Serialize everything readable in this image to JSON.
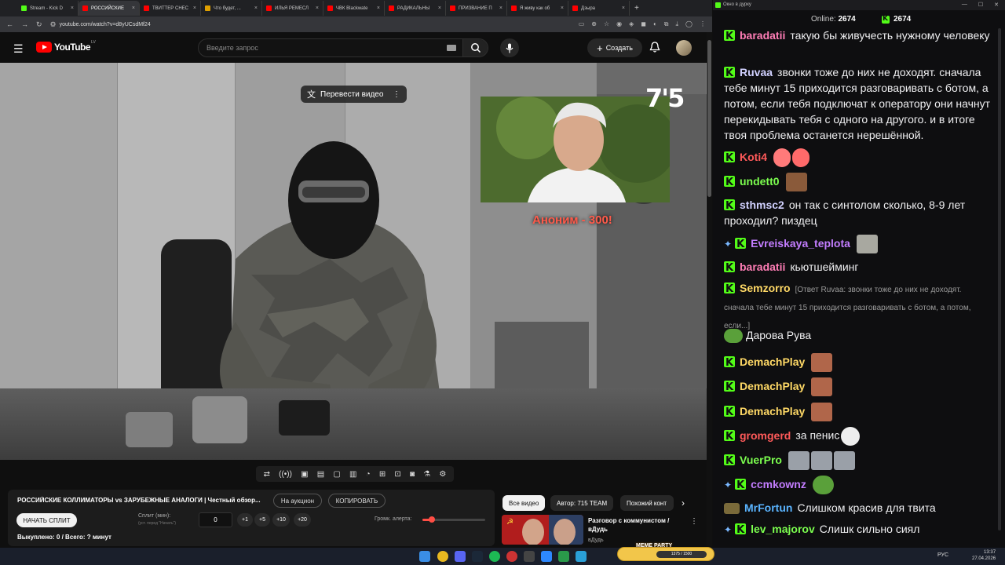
{
  "browser": {
    "tabs": [
      {
        "label": "Stream - Kick D",
        "color": "#53fc18"
      },
      {
        "label": "РОССИЙСКИЕ",
        "color": "#ff0000",
        "active": true
      },
      {
        "label": "ТВИТТЕР СНЕС",
        "color": "#ff0000"
      },
      {
        "label": "Что будет, ...",
        "color": "#e0a000"
      },
      {
        "label": "ИЛЬЯ РЕМЕСЛ",
        "color": "#ff0000"
      },
      {
        "label": "ЧВК Blackwate",
        "color": "#ff0000"
      },
      {
        "label": "РАДИКАЛЬНЫ",
        "color": "#ff0000"
      },
      {
        "label": "ПРИЗВАНИЕ П",
        "color": "#ff0000"
      },
      {
        "label": "Я живу как об",
        "color": "#ff0000"
      },
      {
        "label": "Дзыра",
        "color": "#ff0000"
      }
    ],
    "url": "youtube.com/watch?v=d8yUCsdMf24"
  },
  "youtube": {
    "logo_text": "YouTube",
    "logo_country": "LV",
    "search_placeholder": "Введите запрос",
    "create_label": "Создать"
  },
  "video": {
    "translate_label": "Перевести видео",
    "brand": "7'5",
    "donation_overlay": "Аноним - 300!"
  },
  "below_video": {
    "title": "РОССИЙСКИЕ КОЛЛИМАТОРЫ vs ЗАРУБЕЖНЫЕ АНАЛОГИ | Честный обзор...",
    "auction_button": "На аукцион",
    "copy_button": "КОПИРОВАТЬ",
    "start_split_button": "НАЧАТЬ СПЛИТ",
    "split_label": "Сплит (мин):",
    "split_hint": "(уст. перед \"Начать\")",
    "split_value": "0",
    "split_buttons": [
      "+1",
      "+5",
      "+10",
      "+20"
    ],
    "volume_label": "Громк. алерта:",
    "volume_level": 0.15,
    "bought_text": "Выкуплено: 0 / Всего: ? минут"
  },
  "related": {
    "chips": [
      "Все видео",
      "Автор: 715 TEAM",
      "Похожий конт"
    ],
    "item_title": "Разговор с коммунистом / вДудь",
    "item_channel": "вДудь"
  },
  "chat": {
    "window_title": "Окно в дурку",
    "online_label": "Online:",
    "online_count": "2674",
    "viewer_count": "2674",
    "messages": [
      {
        "user": "baradatii",
        "color": "#ff7eb6",
        "text": "такую бы живучесть нужному человеку"
      },
      {
        "user": "Ruvaa",
        "color": "#d1d1ff",
        "text": "звонки тоже до них не доходят. сначала тебе минут 15 приходится разговаривать с ботом, а потом, если тебя подключат к оператору они начнут перекидывать тебя с одного на другого. и в итоге твоя проблема останется нерешённой."
      },
      {
        "user": "Koti4",
        "color": "#ff5a5a",
        "text": ""
      },
      {
        "user": "undett0",
        "color": "#7cff4f",
        "text": ""
      },
      {
        "user": "sthmsc2",
        "color": "#d1d1ff",
        "text": "он так с синтолом сколько, 8-9 лет проходил? пиздец"
      },
      {
        "user": "Evreiskaya_teplota",
        "color": "#c37dff",
        "text": ""
      },
      {
        "user": "baradatii",
        "color": "#ff7eb6",
        "text": "кьютшейминг"
      },
      {
        "user": "Semzorro",
        "color": "#ffd966",
        "text": "[Ответ Ruvaa: звонки тоже до них не доходят. сначала тебе минут 15 приходится разговаривать с ботом, а потом, если...]"
      },
      {
        "user": "",
        "color": "#efeff1",
        "text": "Дарова Рува"
      },
      {
        "user": "DemachPlay",
        "color": "#ffd966",
        "text": ""
      },
      {
        "user": "DemachPlay",
        "color": "#ffd966",
        "text": ""
      },
      {
        "user": "DemachPlay",
        "color": "#ffd966",
        "text": ""
      },
      {
        "user": "gromgerd",
        "color": "#ff5a5a",
        "text": "за пенис"
      },
      {
        "user": "VuerPro",
        "color": "#7cff4f",
        "text": ""
      },
      {
        "user": "ccmkownz",
        "color": "#c37dff",
        "text": ""
      },
      {
        "user": "MrFortun",
        "color": "#5ab4ff",
        "text": "Слишком красив для твита"
      },
      {
        "user": "lev_majorov",
        "color": "#7cff4f",
        "text": "Слишк сильно сиял"
      }
    ]
  },
  "taskbar": {
    "meme_label": "MEME PARTY",
    "meme_progress": "1375 / 1500",
    "lang": "РУС",
    "time": "13:37",
    "date": "27.04.2026"
  }
}
